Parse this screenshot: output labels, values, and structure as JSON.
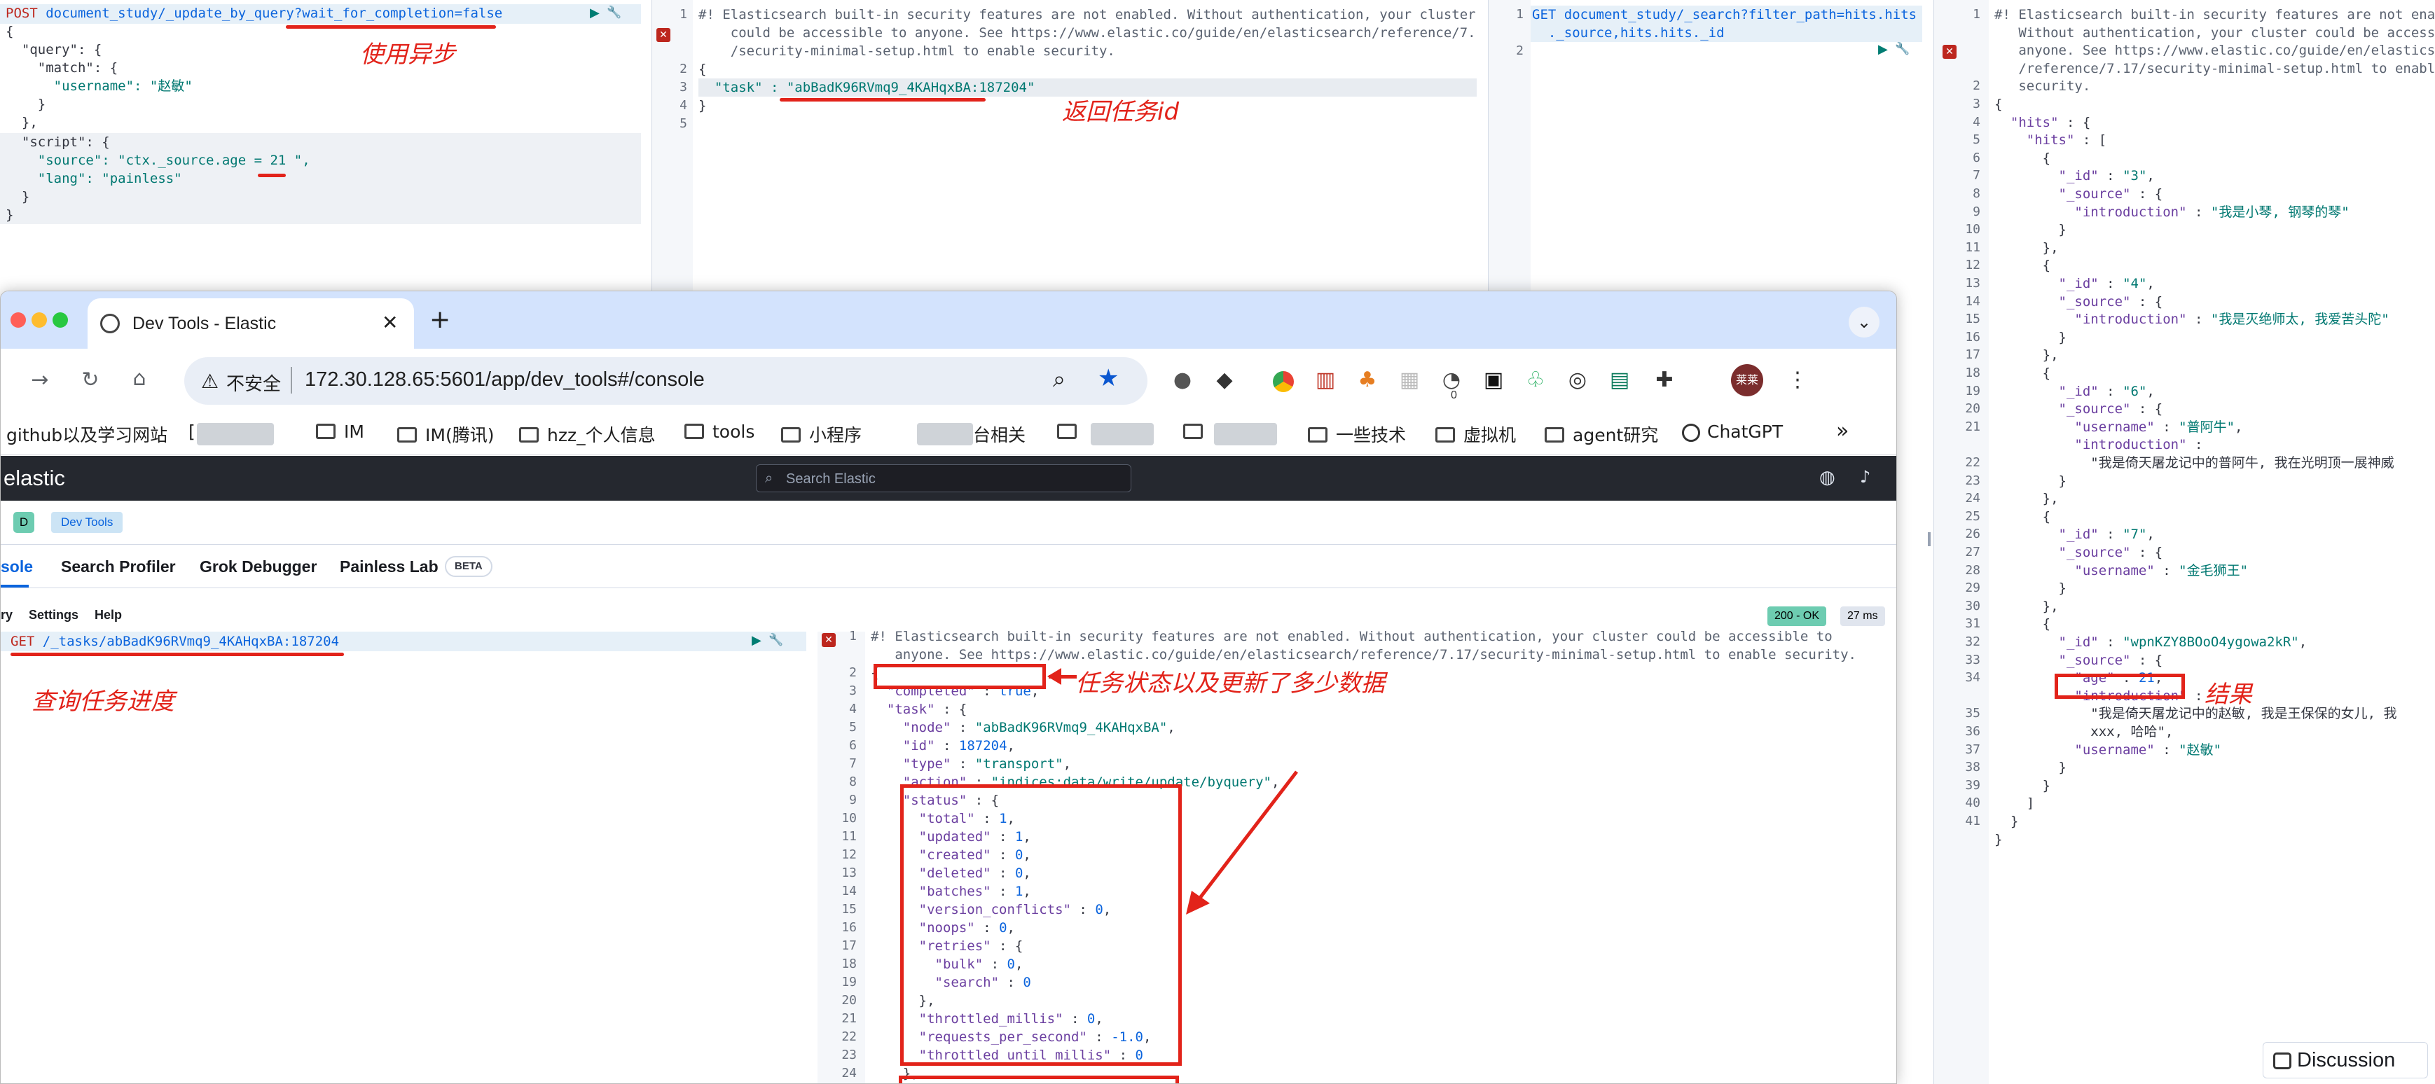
{
  "top_left_panel": {
    "lines": [
      {
        "method": "POST",
        "path": " document_study/_update_by_query",
        "query": "?wait_for_completion=false"
      },
      {
        "text": "{"
      },
      {
        "text": "  \"query\": {"
      },
      {
        "text": "    \"match\": {"
      },
      {
        "text": "      \"username\": \"赵敏\""
      },
      {
        "text": "    }"
      },
      {
        "text": "  },"
      },
      {
        "text": "  \"script\": {"
      },
      {
        "text": "    \"source\": \"ctx._source.age = 21 \","
      },
      {
        "text": "    \"lang\": \"painless\""
      },
      {
        "text": "  }"
      },
      {
        "text": "}"
      }
    ],
    "annotation": "使用异步"
  },
  "top_mid_panel": {
    "line_numbers": [
      "1",
      "",
      "",
      "2",
      "3",
      "4",
      "5"
    ],
    "lines": [
      "#! Elasticsearch built-in security features are not enabled. Without authentication, your cluster",
      "    could be accessible to anyone. See https://www.elastic.co/guide/en/elasticsearch/reference/7.17",
      "    /security-minimal-setup.html to enable security.",
      "{",
      "  \"task\" : \"abBadK96RVmq9_4KAHqxBA:187204\"",
      "}",
      ""
    ],
    "annotation": "返回任务id"
  },
  "top_right_req_panel": {
    "line_numbers": [
      "1",
      "",
      "2"
    ],
    "lines": [
      "GET document_study/_search?filter_path=hits.hits",
      "  ._source,hits.hits._id",
      ""
    ]
  },
  "right_panel": {
    "line_numbers": [
      "1",
      "",
      "",
      "",
      "2",
      "3",
      "4",
      "5",
      "6",
      "7",
      "8",
      "9",
      "10",
      "11",
      "12",
      "13",
      "14",
      "15",
      "16",
      "17",
      "18",
      "19",
      "20",
      "21",
      "",
      "22",
      "23",
      "24",
      "25",
      "26",
      "27",
      "28",
      "29",
      "30",
      "31",
      "32",
      "33",
      "34",
      "",
      "35",
      "36",
      "37",
      "38",
      "39",
      "40",
      "41"
    ],
    "lines": [
      "#! Elasticsearch built-in security features are not enable",
      "   Without authentication, your cluster could be accessib",
      "   anyone. See https://www.elastic.co/guide/en/elasticsear",
      "   /reference/7.17/security-minimal-setup.html to enable",
      "   security.",
      "{",
      "  \"hits\" : {",
      "    \"hits\" : [",
      "      {",
      "        \"_id\" : \"3\",",
      "        \"_source\" : {",
      "          \"introduction\" : \"我是小琴, 钢琴的琴\"",
      "        }",
      "      },",
      "      {",
      "        \"_id\" : \"4\",",
      "        \"_source\" : {",
      "          \"introduction\" : \"我是灭绝师太, 我爱苦头陀\"",
      "        }",
      "      },",
      "      {",
      "        \"_id\" : \"6\",",
      "        \"_source\" : {",
      "          \"username\" : \"普阿牛\",",
      "          \"introduction\" :",
      "            \"我是倚天屠龙记中的普阿牛, 我在光明顶一展神威",
      "        }",
      "      },",
      "      {",
      "        \"_id\" : \"7\",",
      "        \"_source\" : {",
      "          \"username\" : \"金毛狮王\"",
      "        }",
      "      },",
      "      {",
      "        \"_id\" : \"wpnKZY8BOoO4ygowa2kR\",",
      "        \"_source\" : {",
      "          \"age\" : 21,",
      "          \"introduction\" :",
      "            \"我是倚天屠龙记中的赵敏, 我是王保保的女儿, 我",
      "            xxx, 哈哈\",",
      "          \"username\" : \"赵敏\"",
      "        }",
      "      }",
      "    ]",
      "  }",
      "}",
      ""
    ],
    "annotation": "结果"
  },
  "browser": {
    "tab_title": "Dev Tools - Elastic",
    "new_tab": "+",
    "insecure_label": "不安全",
    "url": "172.30.128.65:5601/app/dev_tools#/console",
    "extension_badge": "0",
    "profile_label": "莱莱",
    "bookmarks": [
      {
        "label": "github以及学习网站",
        "type": "text"
      },
      {
        "label": "IM",
        "type": "folder"
      },
      {
        "label": "IM(腾讯)",
        "type": "folder"
      },
      {
        "label": "hzz_个人信息",
        "type": "folder"
      },
      {
        "label": "tools",
        "type": "folder"
      },
      {
        "label": "小程序",
        "type": "folder"
      },
      {
        "label": "台相关",
        "type": "folder"
      },
      {
        "label": "一些技术",
        "type": "folder"
      },
      {
        "label": "虚拟机",
        "type": "folder"
      },
      {
        "label": "agent研究",
        "type": "folder"
      },
      {
        "label": "ChatGPT",
        "type": "app"
      }
    ],
    "more": "»"
  },
  "kibana": {
    "brand": "elastic",
    "search_placeholder": "Search Elastic",
    "space_letter": "D",
    "breadcrumb": "Dev Tools",
    "tabs": [
      "sole",
      "Search Profiler",
      "Grok Debugger",
      "Painless Lab"
    ],
    "beta": "BETA",
    "toolbar": [
      "ry",
      "Settings",
      "Help"
    ],
    "status": "200 - OK",
    "time": "27 ms",
    "request": {
      "method": "GET",
      "path": " /_tasks/abBadK96RVmq9_4KAHqxBA:187204"
    },
    "request_annotation": "查询任务进度",
    "response_line_numbers": [
      "1",
      "",
      "2",
      "3",
      "4",
      "5",
      "6",
      "7",
      "8",
      "9",
      "10",
      "11",
      "12",
      "13",
      "14",
      "15",
      "16",
      "17",
      "18",
      "19",
      "20",
      "21",
      "22",
      "23",
      "24"
    ],
    "response_lines": [
      "#! Elasticsearch built-in security features are not enabled. Without authentication, your cluster could be accessible to",
      "   anyone. See https://www.elastic.co/guide/en/elasticsearch/reference/7.17/security-minimal-setup.html to enable security.",
      "{",
      "  \"completed\" : true,",
      "  \"task\" : {",
      "    \"node\" : \"abBadK96RVmq9_4KAHqxBA\",",
      "    \"id\" : 187204,",
      "    \"type\" : \"transport\",",
      "    \"action\" : \"indices:data/write/update/byquery\",",
      "    \"status\" : {",
      "      \"total\" : 1,",
      "      \"updated\" : 1,",
      "      \"created\" : 0,",
      "      \"deleted\" : 0,",
      "      \"batches\" : 1,",
      "      \"version_conflicts\" : 0,",
      "      \"noops\" : 0,",
      "      \"retries\" : {",
      "        \"bulk\" : 0,",
      "        \"search\" : 0",
      "      },",
      "      \"throttled_millis\" : 0,",
      "      \"requests_per_second\" : -1.0,",
      "      \"throttled_until_millis\" : 0",
      "    },"
    ],
    "response_annotation": "任务状态以及更新了多少数据"
  },
  "discussion_button": "Discussion",
  "colors": {
    "annotation_red": "#e2231a",
    "kibana_header": "#25282f",
    "tab_strip": "#d3e3fd",
    "status_ok": "#6dccb1"
  }
}
